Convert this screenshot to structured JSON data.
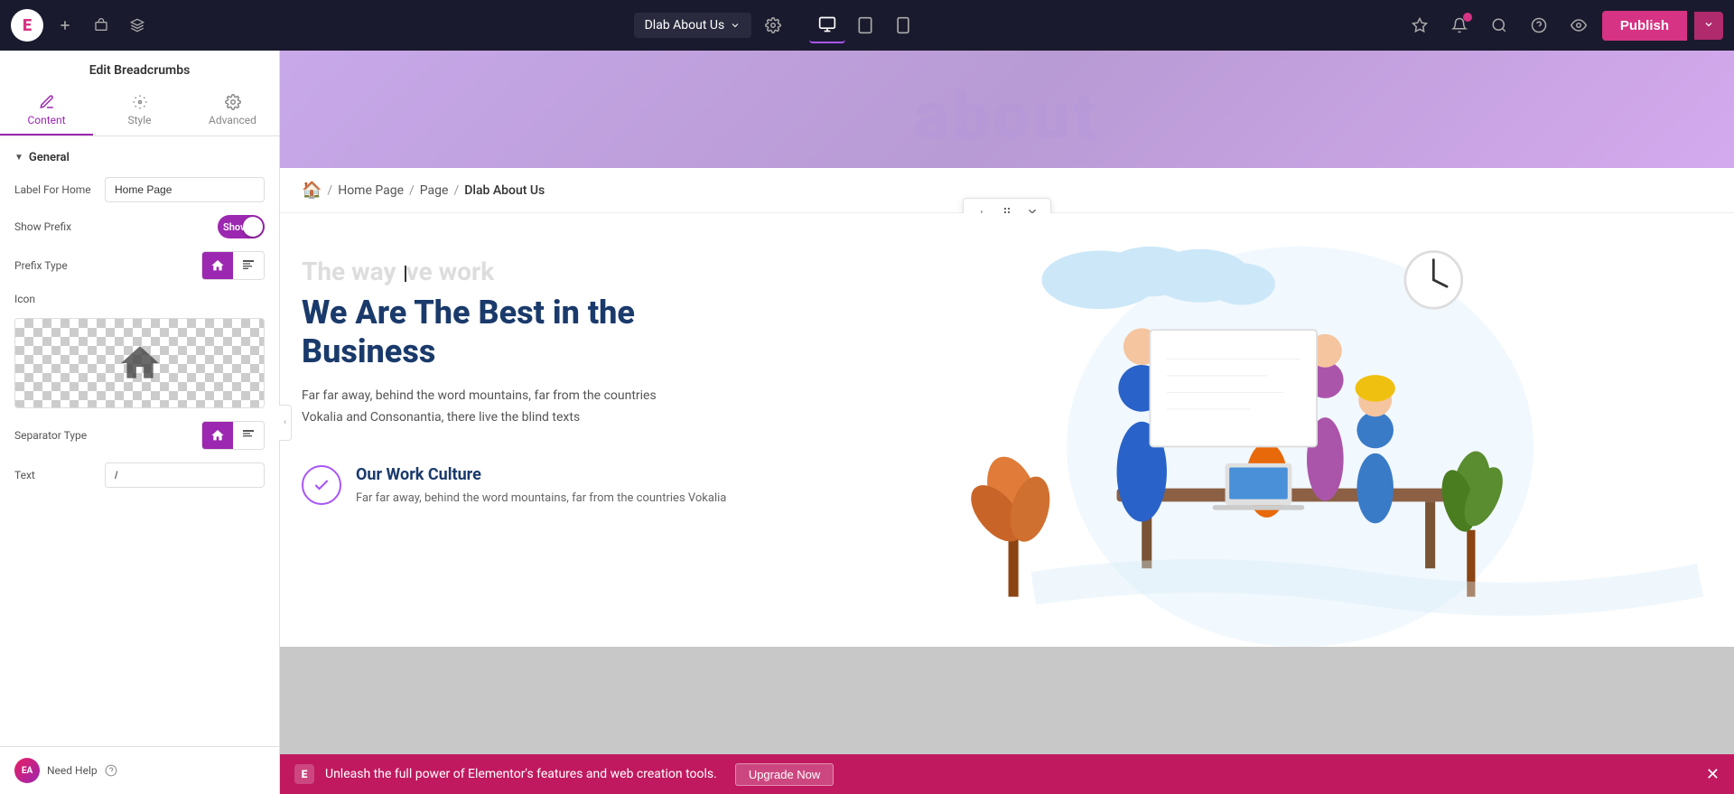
{
  "topbar": {
    "logo_text": "E",
    "page_title": "Dlab About Us",
    "publish_label": "Publish"
  },
  "left_panel": {
    "title": "Edit Breadcrumbs",
    "tabs": [
      {
        "id": "content",
        "label": "Content",
        "active": true
      },
      {
        "id": "style",
        "label": "Style",
        "active": false
      },
      {
        "id": "advanced",
        "label": "Advanced",
        "active": false
      }
    ],
    "general_section": {
      "label": "General",
      "label_for_home_label": "Label For Home",
      "label_for_home_value": "Home Page",
      "show_prefix_label": "Show Prefix",
      "show_prefix_toggle": "Show",
      "prefix_type_label": "Prefix Type",
      "icon_label": "Icon",
      "separator_type_label": "Separator Type",
      "text_label": "Text",
      "text_value": "/"
    },
    "need_help_label": "Need Help",
    "need_help_avatar": "EA"
  },
  "breadcrumb": {
    "home_icon": "🏠",
    "items": [
      {
        "label": "Home Page"
      },
      {
        "label": "Page"
      },
      {
        "label": "Dlab About Us",
        "current": true
      }
    ],
    "separator": "/"
  },
  "main_content": {
    "watermark": "The way we work",
    "heading": "We Are The Best in the Business",
    "description": "Far far away, behind the word mountains, far from the countries Vokalia and Consonantia, there live the blind texts",
    "work_culture": {
      "title": "Our Work Culture",
      "description": "Far far away, behind the word mountains, far from the countries Vokalia"
    }
  },
  "notification_bar": {
    "message": "Unleash the full power of Elementor's features and web creation tools.",
    "upgrade_label": "Upgrade Now",
    "icon": "E"
  }
}
